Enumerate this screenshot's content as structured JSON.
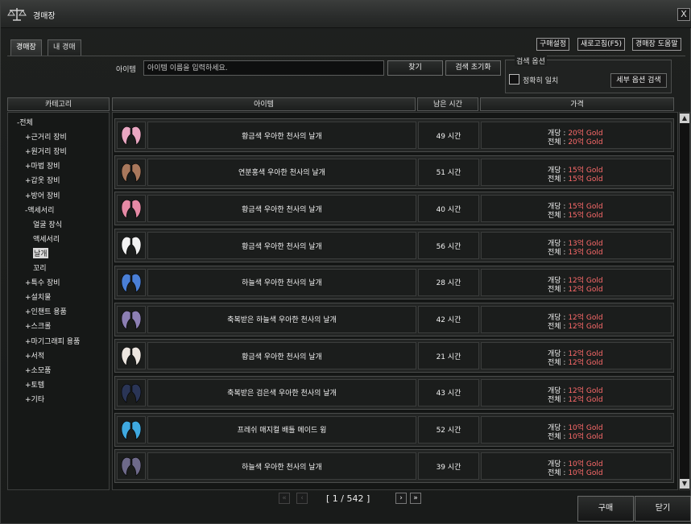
{
  "window": {
    "title": "경매장",
    "close_label": "X"
  },
  "tabs": [
    {
      "label": "경매장",
      "active": true
    },
    {
      "label": "내 경매",
      "active": false
    }
  ],
  "top_buttons": {
    "purchase_settings": "구매설정",
    "refresh": "새로고침(F5)",
    "help": "경매장 도움말"
  },
  "search": {
    "label": "아이템",
    "placeholder": "아이템 이름을 입력하세요.",
    "find_button": "찾기",
    "reset_button": "검색 초기화",
    "options_title": "검색 옵션",
    "exact_match_label": "정확히 일치",
    "exact_match_checked": false,
    "detail_button": "세부 옵션 검색"
  },
  "columns": {
    "category": "카테고리",
    "item": "아이템",
    "time_left": "남은 시간",
    "price": "가격"
  },
  "categories": [
    {
      "label": "-전체"
    },
    {
      "label": "+근거리 장비"
    },
    {
      "label": "+원거리 장비"
    },
    {
      "label": "+마법 장비"
    },
    {
      "label": "+갑옷 장비"
    },
    {
      "label": "+방어 장비"
    },
    {
      "label": "-액세서리"
    },
    {
      "label": "얼굴 장식"
    },
    {
      "label": "액세서리"
    },
    {
      "label": "날개",
      "selected": true
    },
    {
      "label": "꼬리"
    },
    {
      "label": "+특수 장비"
    },
    {
      "label": "+설치물"
    },
    {
      "label": "+인챈트 용품"
    },
    {
      "label": "+스크롤"
    },
    {
      "label": "+마기그래피 용품"
    },
    {
      "label": "+서적"
    },
    {
      "label": "+소모품"
    },
    {
      "label": "+토템"
    },
    {
      "label": "+기타"
    }
  ],
  "price_labels": {
    "unit": "개당 : ",
    "total": "전체 : "
  },
  "listings": [
    {
      "icon": "pink-wings-icon",
      "icon_color": "#e9a7c2",
      "name": "황금색 우아한 천사의 날개",
      "time": "49 시간",
      "unit_price": "20억 Gold",
      "total_price": "20억 Gold"
    },
    {
      "icon": "brown-wings-icon",
      "icon_color": "#a8785c",
      "name": "연분홍색 우아한 천사의 날개",
      "time": "51 시간",
      "unit_price": "15억 Gold",
      "total_price": "15억 Gold"
    },
    {
      "icon": "pink-wings-icon",
      "icon_color": "#e58aa5",
      "name": "황금색 우아한 천사의 날개",
      "time": "40 시간",
      "unit_price": "15억 Gold",
      "total_price": "15억 Gold"
    },
    {
      "icon": "white-wings-icon",
      "icon_color": "#f2f2f2",
      "name": "황금색 우아한 천사의 날개",
      "time": "56 시간",
      "unit_price": "13억 Gold",
      "total_price": "13억 Gold"
    },
    {
      "icon": "blue-wings-icon",
      "icon_color": "#4a7fd6",
      "name": "하늘색 우아한 천사의 날개",
      "time": "28 시간",
      "unit_price": "12억 Gold",
      "total_price": "12억 Gold"
    },
    {
      "icon": "purple-wings-icon",
      "icon_color": "#8c7fb3",
      "name": "축복받은 하늘색 우아한 천사의 날개",
      "time": "42 시간",
      "unit_price": "12억 Gold",
      "total_price": "12억 Gold"
    },
    {
      "icon": "white-wings-icon",
      "icon_color": "#ece6e0",
      "name": "황금색 우아한 천사의 날개",
      "time": "21 시간",
      "unit_price": "12억 Gold",
      "total_price": "12억 Gold"
    },
    {
      "icon": "dark-wings-icon",
      "icon_color": "#2a3556",
      "name": "축복받은 검은색 우아한 천사의 날개",
      "time": "43 시간",
      "unit_price": "12억 Gold",
      "total_price": "12억 Gold"
    },
    {
      "icon": "blue-wing-emblem-icon",
      "icon_color": "#3fa9e0",
      "name": "프레쉬 매지컬 배틀 메이드 윙",
      "time": "52 시간",
      "unit_price": "10억 Gold",
      "total_price": "10억 Gold"
    },
    {
      "icon": "purple-wings-icon",
      "icon_color": "#6e6a8a",
      "name": "하늘색 우아한 천사의 날개",
      "time": "39 시간",
      "unit_price": "10억 Gold",
      "total_price": "10억 Gold"
    }
  ],
  "pager": {
    "info": "[ 1 / 542 ]",
    "first": "«",
    "prev": "‹",
    "next": "›",
    "last": "»"
  },
  "footer": {
    "buy": "구매",
    "close": "닫기"
  }
}
